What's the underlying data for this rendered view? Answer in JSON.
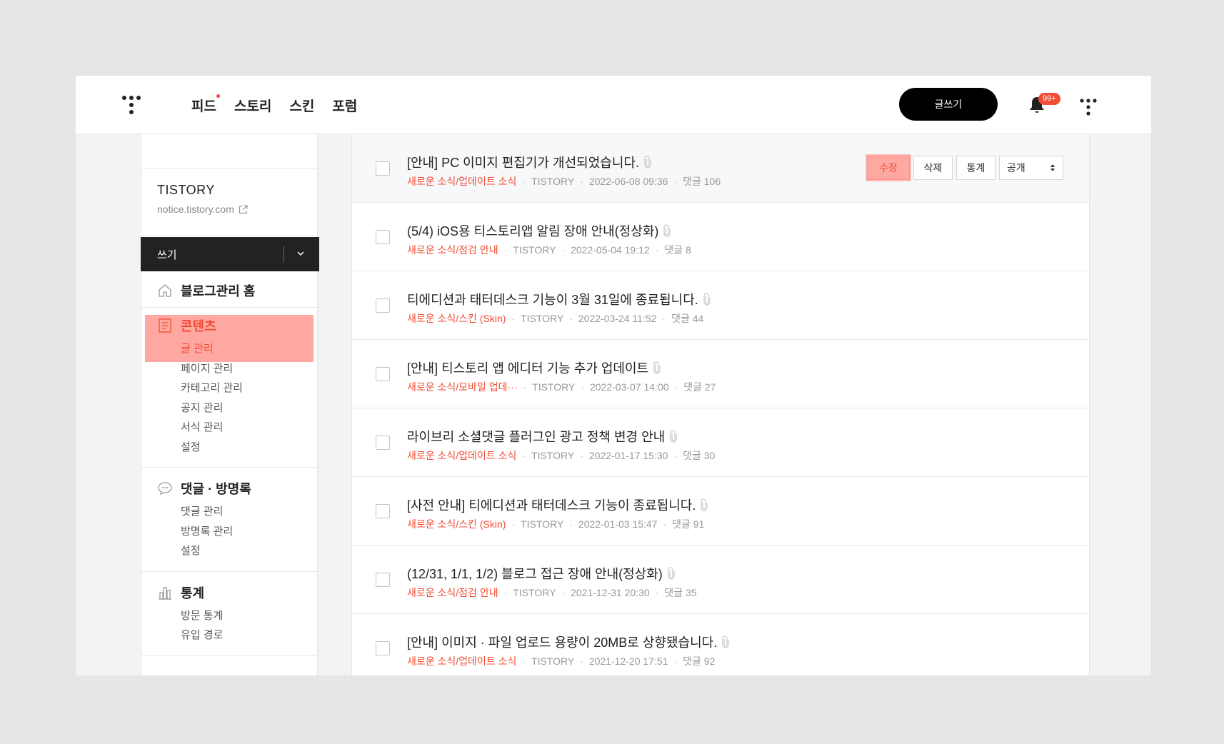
{
  "header": {
    "nav": [
      {
        "label": "피드",
        "dot": true
      },
      {
        "label": "스토리",
        "dot": false
      },
      {
        "label": "스킨",
        "dot": false
      },
      {
        "label": "포럼",
        "dot": false
      }
    ],
    "write_button": "글쓰기",
    "notification_badge": "99+",
    "accent_color": "#f04e34"
  },
  "sidebar": {
    "blog_name": "TISTORY",
    "blog_url": "notice.tistory.com",
    "write_label": "쓰기",
    "groups": [
      {
        "icon": "home-icon",
        "label": "블로그관리 홈",
        "items": []
      },
      {
        "icon": "document-icon",
        "label": "콘텐츠",
        "items": [
          "글 관리",
          "페이지 관리",
          "카테고리 관리",
          "공지 관리",
          "서식 관리",
          "설정"
        ]
      },
      {
        "icon": "speech-bubble-icon",
        "label": "댓글 · 방명록",
        "items": [
          "댓글 관리",
          "방명록 관리",
          "설정"
        ]
      },
      {
        "icon": "bar-chart-icon",
        "label": "통계",
        "items": [
          "방문 통계",
          "유입 경로"
        ]
      }
    ]
  },
  "actions": {
    "edit": "수정",
    "delete": "삭제",
    "stats": "통계",
    "visibility": "공개"
  },
  "posts": [
    {
      "title": "[안내] PC 이미지 편집기가 개선되었습니다.",
      "category": "새로운 소식/업데이트 소식",
      "author": "TISTORY",
      "date": "2022-06-08 09:36",
      "comments": "댓글 106"
    },
    {
      "title": "(5/4) iOS용 티스토리앱 알림 장애 안내(정상화)",
      "category": "새로운 소식/점검 안내",
      "author": "TISTORY",
      "date": "2022-05-04 19:12",
      "comments": "댓글 8"
    },
    {
      "title": "티에디션과 태터데스크 기능이 3월 31일에 종료됩니다.",
      "category": "새로운 소식/스킨 (Skin)",
      "author": "TISTORY",
      "date": "2022-03-24 11:52",
      "comments": "댓글 44"
    },
    {
      "title": "[안내] 티스토리 앱 에디터 기능 추가 업데이트",
      "category": "새로운 소식/모바일 업데···",
      "author": "TISTORY",
      "date": "2022-03-07 14:00",
      "comments": "댓글 27"
    },
    {
      "title": "라이브리 소셜댓글 플러그인 광고 정책 변경 안내",
      "category": "새로운 소식/업데이트 소식",
      "author": "TISTORY",
      "date": "2022-01-17 15:30",
      "comments": "댓글 30"
    },
    {
      "title": "[사전 안내] 티에디션과 태터데스크 기능이 종료됩니다.",
      "category": "새로운 소식/스킨 (Skin)",
      "author": "TISTORY",
      "date": "2022-01-03 15:47",
      "comments": "댓글 91"
    },
    {
      "title": "(12/31, 1/1, 1/2) 블로그 접근 장애 안내(정상화)",
      "category": "새로운 소식/점검 안내",
      "author": "TISTORY",
      "date": "2021-12-31 20:30",
      "comments": "댓글 35"
    },
    {
      "title": "[안내] 이미지 · 파일 업로드 용량이 20MB로 상향됐습니다.",
      "category": "새로운 소식/업데이트 소식",
      "author": "TISTORY",
      "date": "2021-12-20 17:51",
      "comments": "댓글 92"
    }
  ]
}
